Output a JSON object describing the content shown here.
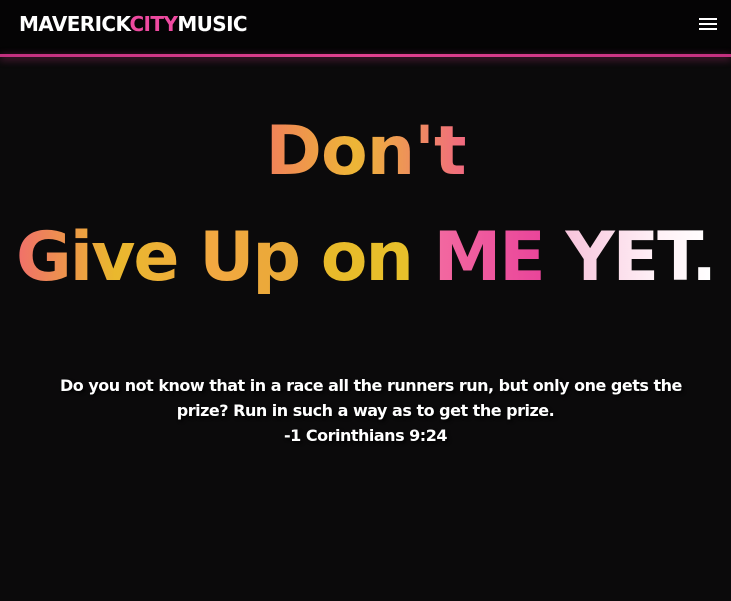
{
  "header": {
    "brand_part1": "MAVERICK",
    "brand_part2": "CITY",
    "brand_part3": "MUSIC",
    "menu_icon": "hamburger-menu-icon"
  },
  "hero": {
    "line1": "Don't",
    "line2_word1": "Give Up",
    "line2_word2": "on",
    "line2_word3": "ME",
    "line2_word4": "YET."
  },
  "quote": {
    "line1": "Do you not know that in a race all the runners run, but only one gets the",
    "line2": "prize? Run in such a way as to get the prize.",
    "citation": "-1 Corinthians 9:24"
  },
  "colors": {
    "accent_pink": "#ee4aa0",
    "background": "#0b0a0b",
    "header_bg": "#050405"
  }
}
